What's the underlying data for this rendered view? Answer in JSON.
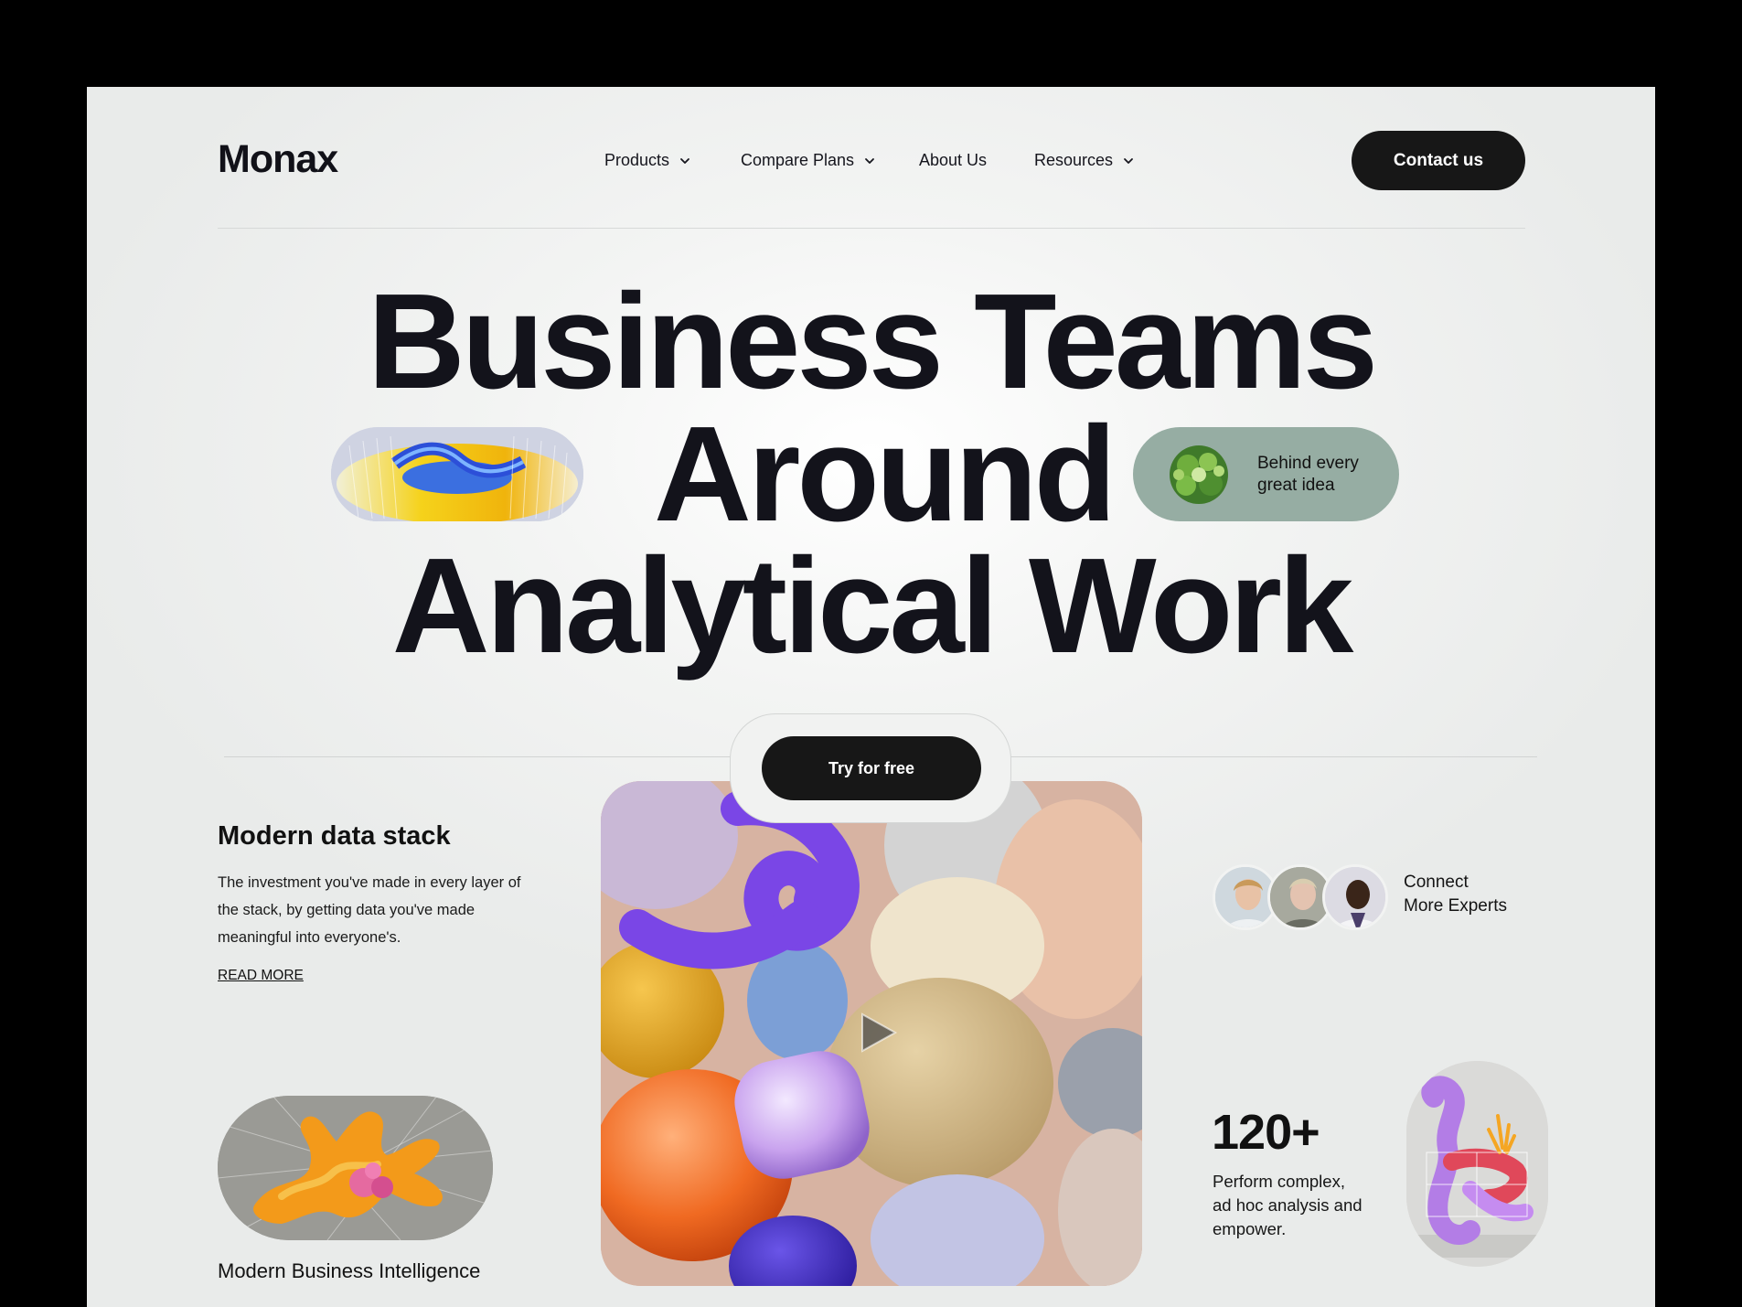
{
  "brand": {
    "logo": "Monax"
  },
  "nav": {
    "items": [
      {
        "label": "Products",
        "has_dropdown": true
      },
      {
        "label": "Compare Plans",
        "has_dropdown": true
      },
      {
        "label": "About Us",
        "has_dropdown": false
      },
      {
        "label": "Resources",
        "has_dropdown": true
      }
    ],
    "contact_label": "Contact us"
  },
  "hero": {
    "line1": "Business Teams",
    "line2": "Around",
    "line3": "Analytical Work",
    "badge_line1": "Behind every",
    "badge_line2": "great idea"
  },
  "cta": {
    "try_label": "Try for free"
  },
  "left": {
    "title": "Modern data stack",
    "description": "The investment you've made in every layer of the stack, by getting data you've made meaningful into everyone's.",
    "read_more": "READ MORE",
    "bi_label": "Modern Business Intelligence"
  },
  "right": {
    "connect_line1": "Connect",
    "connect_line2": "More Experts",
    "stat_number": "120+",
    "stat_description": "Perform complex, ad hoc analysis and empower."
  },
  "icons": {
    "nav_dropdown": "chevron-down-icon",
    "video": "play-icon"
  },
  "colors": {
    "dark": "#171717",
    "background": "#f1f2f1",
    "badge_green": "#96ada3",
    "text": "#14141c"
  }
}
